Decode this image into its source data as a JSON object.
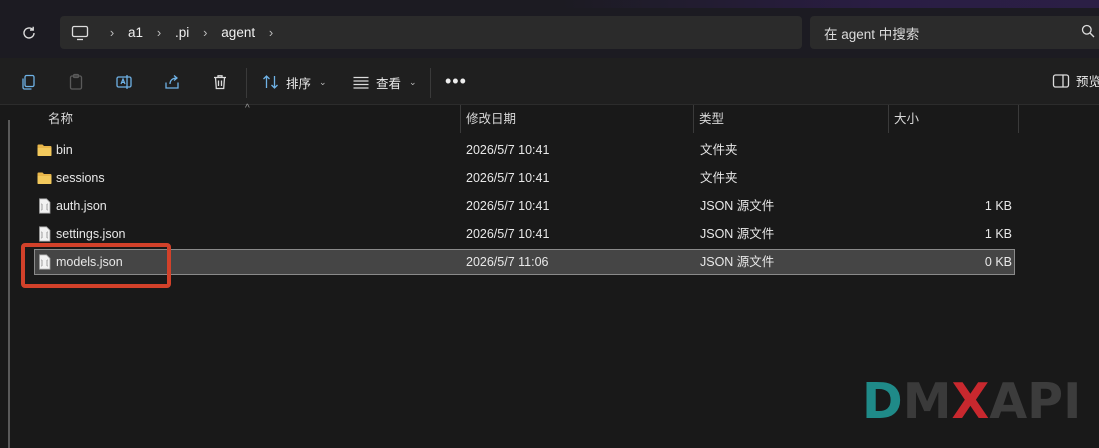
{
  "address_bar": {
    "breadcrumbs": [
      "a1",
      ".pi",
      "agent"
    ],
    "search_placeholder": "在 agent 中搜索"
  },
  "toolbar": {
    "sort_label": "排序",
    "view_label": "查看",
    "more_label": "•••",
    "preview_label": "预览"
  },
  "columns": {
    "name": "名称",
    "modified": "修改日期",
    "type": "类型",
    "size": "大小"
  },
  "files": [
    {
      "name": "bin",
      "modified": "2026/5/7 10:41",
      "type": "文件夹",
      "size": "",
      "kind": "folder-icon"
    },
    {
      "name": "sessions",
      "modified": "2026/5/7 10:41",
      "type": "文件夹",
      "size": "",
      "kind": "folder-icon"
    },
    {
      "name": "auth.json",
      "modified": "2026/5/7 10:41",
      "type": "JSON 源文件",
      "size": "1 KB",
      "kind": "json-file-icon"
    },
    {
      "name": "settings.json",
      "modified": "2026/5/7 10:41",
      "type": "JSON 源文件",
      "size": "1 KB",
      "kind": "json-file-icon"
    },
    {
      "name": "models.json",
      "modified": "2026/5/7 11:06",
      "type": "JSON 源文件",
      "size": "0 KB",
      "kind": "json-file-icon"
    }
  ],
  "selected_file": "models.json",
  "watermark": {
    "d": "D",
    "m": "M",
    "x": "X",
    "api": "API"
  },
  "colors": {
    "highlight_box": "#d2412a",
    "folder": "#e8b64a",
    "logo_teal": "#1f8a88",
    "logo_red": "#c8282e"
  }
}
